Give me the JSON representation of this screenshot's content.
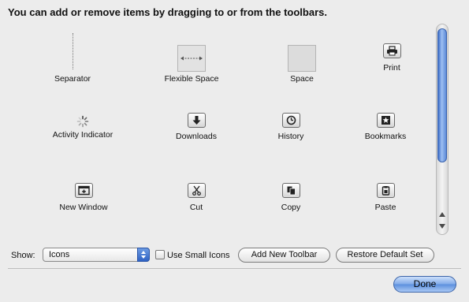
{
  "title": "You can add or remove items by dragging to or from the toolbars.",
  "items": [
    {
      "label": "Separator",
      "icon": "separator-icon"
    },
    {
      "label": "Flexible Space",
      "icon": "flexible-space-icon"
    },
    {
      "label": "Space",
      "icon": "space-icon"
    },
    {
      "label": "Print",
      "icon": "printer-icon"
    },
    {
      "label": "Activity Indicator",
      "icon": "spinner-icon"
    },
    {
      "label": "Downloads",
      "icon": "download-arrow-icon"
    },
    {
      "label": "History",
      "icon": "clock-icon"
    },
    {
      "label": "Bookmarks",
      "icon": "bookmark-star-icon"
    },
    {
      "label": "New Window",
      "icon": "new-window-icon"
    },
    {
      "label": "Cut",
      "icon": "scissors-icon"
    },
    {
      "label": "Copy",
      "icon": "copy-icon"
    },
    {
      "label": "Paste",
      "icon": "clipboard-icon"
    }
  ],
  "show": {
    "label": "Show:",
    "selected": "Icons"
  },
  "small_icons": {
    "label": "Use Small Icons",
    "checked": false
  },
  "buttons": {
    "add_toolbar": "Add New Toolbar",
    "restore": "Restore Default Set",
    "done": "Done"
  },
  "colors": {
    "background": "#ececec",
    "accent": "#5b8fdd"
  }
}
